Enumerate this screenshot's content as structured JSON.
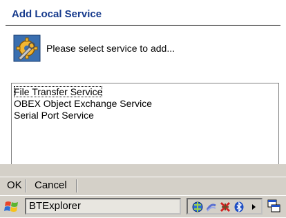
{
  "dialog": {
    "title": "Add Local Service",
    "prompt": "Please select service to add..."
  },
  "services": [
    {
      "label": "File Transfer Service",
      "focused": true
    },
    {
      "label": "OBEX Object Exchange Service",
      "focused": false
    },
    {
      "label": "Serial Port Service",
      "focused": false
    }
  ],
  "menubar": {
    "ok_label": "OK",
    "cancel_label": "Cancel"
  },
  "taskbar": {
    "active_app": "BTExplorer",
    "tray_icons": [
      "network-icon",
      "sync-icon",
      "connection-icon",
      "bluetooth-icon",
      "tray-expand-icon"
    ],
    "desktop_icon": "show-desktop-icon"
  },
  "colors": {
    "title_text": "#163a8c",
    "chrome_gray": "#d4d0c8"
  }
}
